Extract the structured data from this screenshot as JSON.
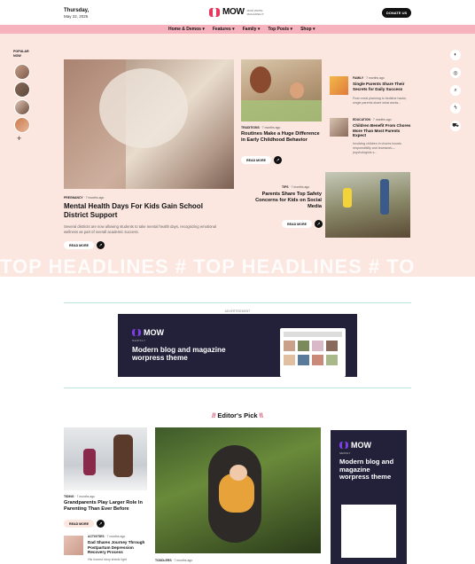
{
  "header": {
    "day": "Thursday,",
    "date": "May 22, 2025",
    "logo_text": "MOW",
    "logo_tagline": "MOM WRITE MAGAZINE IT",
    "donate_label": "DONATE US"
  },
  "nav": {
    "items": [
      {
        "label": "Home & Demos ▾"
      },
      {
        "label": "Features ▾"
      },
      {
        "label": "Family ▾"
      },
      {
        "label": "Top Posts ▾"
      },
      {
        "label": "Shop ▾"
      }
    ]
  },
  "popular": {
    "label": "POPULAR NOW",
    "plus": "+"
  },
  "hero": {
    "main": {
      "category": "PREGNANCY",
      "time": "7 months ago",
      "title": "Mental Health Days For Kids Gain School District Support",
      "excerpt": "Several districts are now allowing students to take mental health days, recognizing emotional wellness as part of overall academic success.",
      "read_more": "READ MORE"
    },
    "article2": {
      "category": "TRADITIONS",
      "time": "7 months ago",
      "title": "Routines Make a Huge Difference in Early Childhood Behavior",
      "read_more": "READ MORE"
    },
    "article3": {
      "category": "TIPS",
      "time": "7 months ago",
      "title": "Parents Share Top Safety Concerns for Kids on Social Media",
      "read_more": "READ MORE"
    },
    "side1": {
      "category": "FAMILY",
      "time": "7 months ago",
      "title": "Single Parents Share Their Secrets for Daily Success",
      "excerpt": "From meal planning to bedtime hacks, single parents share what works..."
    },
    "side2": {
      "category": "EDUCATION",
      "time": "7 months ago",
      "title": "Children Benefit From Chores More Than Most Parents Expect",
      "excerpt": "Involving children in chores boosts responsibility and teamwork—psychologists s..."
    },
    "watermark": "TOP HEADLINES  #  TOP HEADLINES  #  TO"
  },
  "side_icons": [
    {
      "glyph": "◐"
    },
    {
      "glyph": "◎"
    },
    {
      "glyph": "⌕"
    },
    {
      "glyph": "ϟ"
    },
    {
      "glyph": "⛟"
    }
  ],
  "ad": {
    "label": "ADVERTISEMENT",
    "brand": "MOW",
    "sub": "NEWSLY",
    "headline": "Modern blog and magazine worpress theme"
  },
  "editors_pick": {
    "slash_left": "//",
    "title": "Editor's Pick",
    "slash_right": "\\\\",
    "card1": {
      "category": "TIDING",
      "time": "7 months ago",
      "title": "Grandparents Play Larger Role In Parenting Than Ever Before",
      "read_more": "READ MORE"
    },
    "card2": {
      "category": "ACTIVITIES",
      "time": "7 months ago",
      "title": "Dad Shares Journey Through Postpartum Depression Recovery Process",
      "excerpt": "His honest story sheds light"
    },
    "card3": {
      "category": "TODDLERS",
      "time": "7 months ago"
    },
    "ad2": {
      "brand": "MOW",
      "sub": "NEWSLY",
      "headline": "Modern blog and magazine worpress theme"
    }
  }
}
